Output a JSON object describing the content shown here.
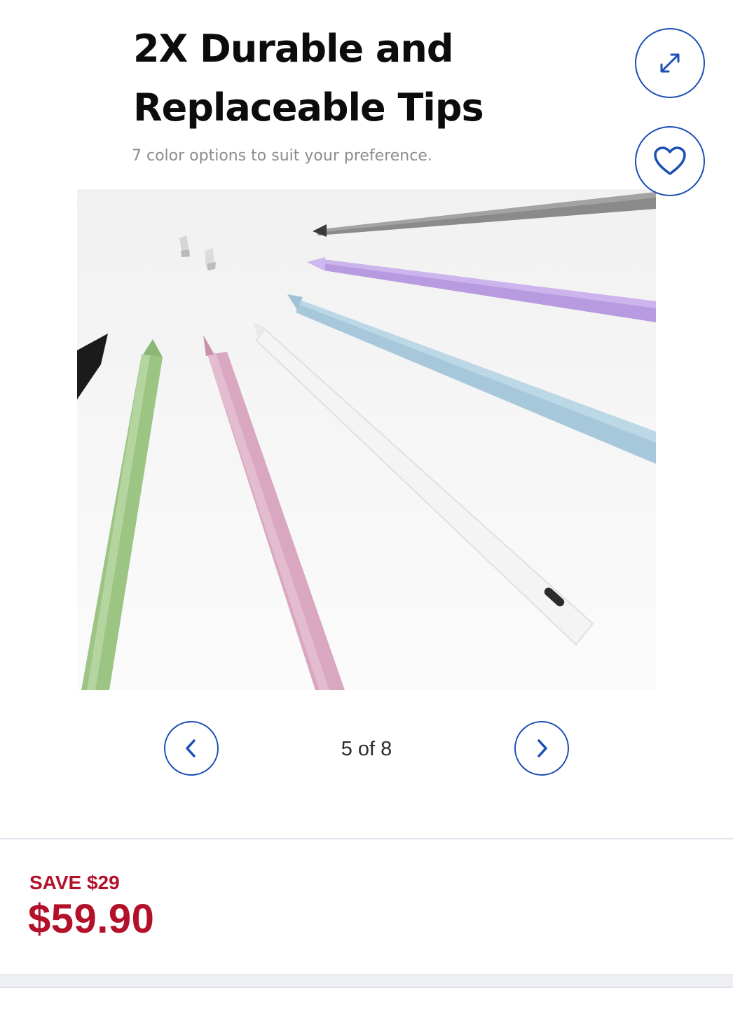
{
  "gallery": {
    "image": {
      "headline": "2X Durable and Replaceable Tips",
      "subline": "7 color options to suit your preference.",
      "pen_colors": [
        "#8a8a8a",
        "#b79ae0",
        "#a7c8db",
        "#f2f2f2",
        "#d9a8c0",
        "#9cc483",
        "#1b1b1b"
      ],
      "tip_color": "#d0d0d0"
    },
    "counter": "5 of 8",
    "icons": {
      "expand": "expand-icon",
      "favorite": "heart-icon",
      "prev": "chevron-left-icon",
      "next": "chevron-right-icon"
    },
    "accent": "#1b4fb5"
  },
  "pricing": {
    "save_label": "SAVE $29",
    "price": "$59.90",
    "color": "#b3102a"
  }
}
